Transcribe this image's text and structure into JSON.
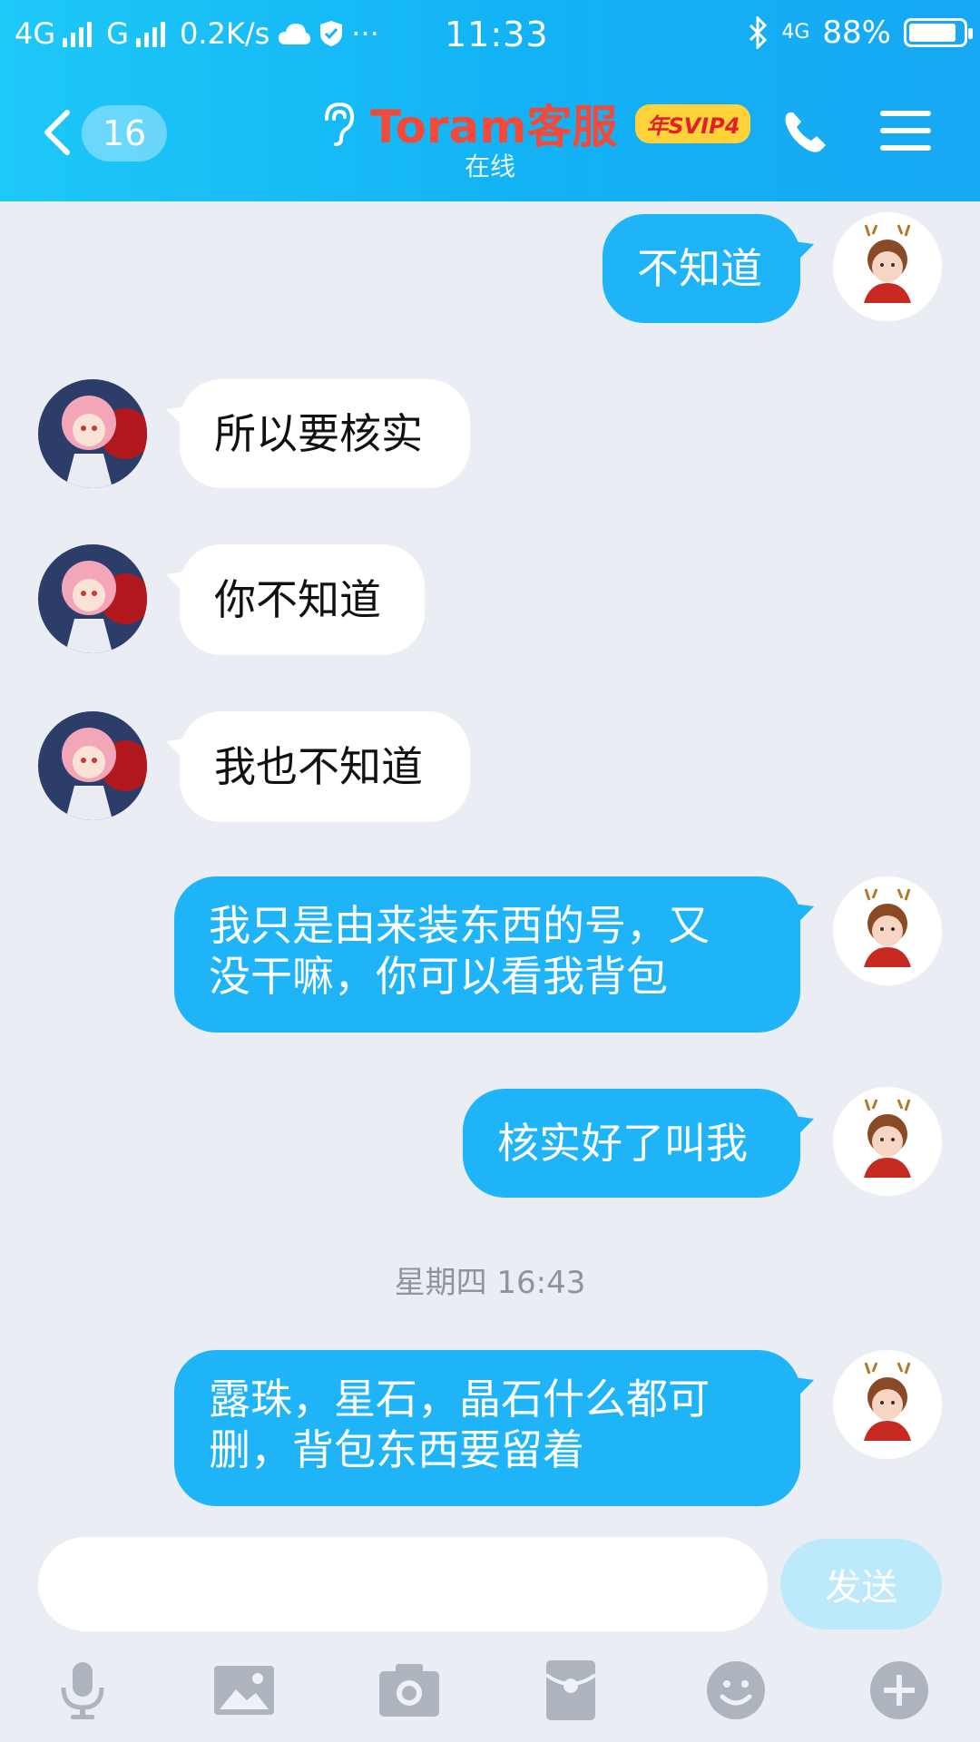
{
  "status_bar": {
    "network1": "4G",
    "network2": "G",
    "speed": "0.2K/s",
    "time": "11:33",
    "network_right": "4G",
    "battery": "88%",
    "battery_level": 0.88
  },
  "header": {
    "unread_count": "16",
    "title": "Toram客服",
    "badge": "年SVIP4",
    "subtitle": "在线"
  },
  "messages": [
    {
      "side": "out",
      "text": "不知道"
    },
    {
      "side": "in",
      "text": "所以要核实"
    },
    {
      "side": "in",
      "text": "你不知道"
    },
    {
      "side": "in",
      "text": "我也不知道"
    },
    {
      "side": "out",
      "lines": [
        "我只是由来装东西的号，又",
        "没干嘛，你可以看我背包"
      ]
    },
    {
      "side": "out",
      "text": "核实好了叫我"
    },
    {
      "side": "out",
      "lines": [
        "露珠，星石，晶石什么都可",
        "删，背包东西要留着"
      ]
    }
  ],
  "timestamp": "星期四 16:43",
  "input": {
    "send_label": "发送",
    "value": ""
  },
  "toolbar": [
    "mic-icon",
    "image-icon",
    "camera-icon",
    "red-packet-icon",
    "emoji-icon",
    "plus-icon"
  ],
  "colors": {
    "header": "#12b2f5",
    "bubble_out": "#1fb4f8",
    "background": "#eaedf4",
    "title": "#f24a3a"
  }
}
